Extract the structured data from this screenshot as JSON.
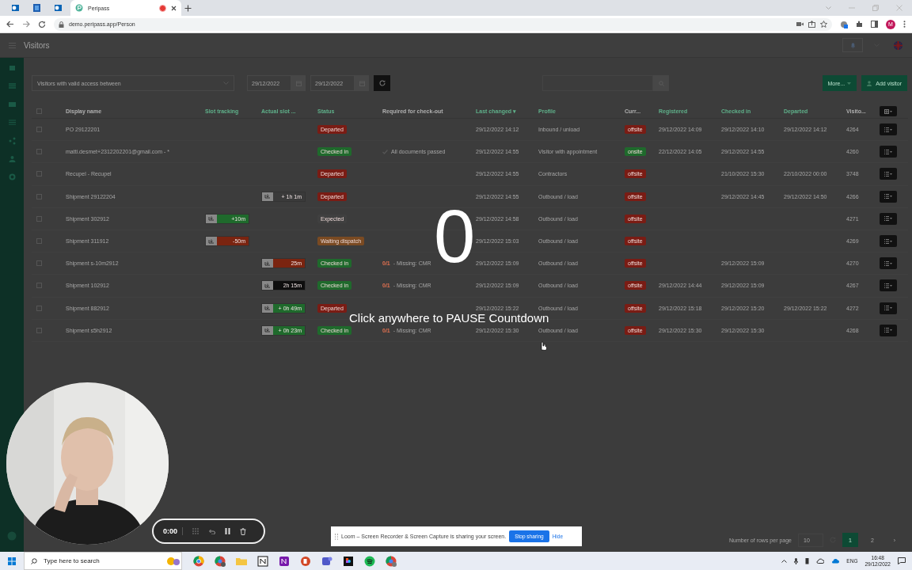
{
  "browser": {
    "tabs": [
      {
        "kind": "icon",
        "selected": false
      },
      {
        "kind": "icon",
        "selected": false
      },
      {
        "kind": "icon",
        "selected": false
      },
      {
        "kind": "page",
        "title": "Peripass",
        "recording": true,
        "selected": true
      }
    ],
    "address": "demo.peripass.app/Person",
    "profile_initial": "M"
  },
  "app": {
    "title": "Visitors",
    "filter": "Visitors with valid access between",
    "date_from": "29/12/2022",
    "date_to": "29/12/2022",
    "buttons": [
      "More...",
      "Add visitor"
    ]
  },
  "table": {
    "select_all_checked": false,
    "columns": [
      {
        "label": "Display name",
        "sortable": false
      },
      {
        "label": "Slot tracking",
        "sortable": true
      },
      {
        "label": "Actual slot ...",
        "sortable": true
      },
      {
        "label": "Status",
        "sortable": true
      },
      {
        "label": "Required for check-out",
        "sortable": false
      },
      {
        "label": "Last changed ▾",
        "sortable": true
      },
      {
        "label": "Profile",
        "sortable": true
      },
      {
        "label": "Curr...",
        "sortable": false
      },
      {
        "label": "Registered",
        "sortable": true
      },
      {
        "label": "Checked in",
        "sortable": true
      },
      {
        "label": "Departed",
        "sortable": true
      },
      {
        "label": "Visito...",
        "sortable": false
      }
    ],
    "rows": [
      {
        "checked": false,
        "name": "PO 29122201",
        "status": {
          "text": "Departed",
          "color": "#7a1c14"
        },
        "last_changed": "29/12/2022 14:12",
        "profile": "Inbound / unload",
        "presence": {
          "text": "offsite",
          "color": "#7a1c14"
        },
        "registered": "29/12/2022 14:09",
        "checked_in": "29/12/2022 14:10",
        "departed": "29/12/2022 14:12",
        "visitor_id": "4264"
      },
      {
        "checked": false,
        "name": "matti.desmet+2312202201@gmail.com - *",
        "status": {
          "text": "Checked in",
          "color": "#1f6a2c"
        },
        "required": {
          "kind": "passed",
          "text": "All documents passed"
        },
        "last_changed": "29/12/2022 14:55",
        "profile": "Visitor with appointment",
        "presence": {
          "text": "onsite",
          "color": "#1f6a2c"
        },
        "registered": "22/12/2022 14:05",
        "checked_in": "29/12/2022 14:55",
        "visitor_id": "4260"
      },
      {
        "checked": false,
        "name": "Recupel - Recupel",
        "status": {
          "text": "Departed",
          "color": "#7a1c14"
        },
        "last_changed": "29/12/2022 14:55",
        "profile": "Contractors",
        "presence": {
          "text": "offsite",
          "color": "#7a1c14"
        },
        "checked_in": "21/10/2022 15:30",
        "departed": "22/10/2022 00:00",
        "visitor_id": "3748"
      },
      {
        "checked": false,
        "name": "Shipment 29122204",
        "actual_slot": {
          "text": "+ 1h 1m",
          "color": "#3a3a3a"
        },
        "status": {
          "text": "Departed",
          "color": "#7a1c14"
        },
        "last_changed": "29/12/2022 14:55",
        "profile": "Outbound / load",
        "presence": {
          "text": "offsite",
          "color": "#7a1c14"
        },
        "checked_in": "29/12/2022 14:45",
        "departed": "29/12/2022 14:50",
        "visitor_id": "4266"
      },
      {
        "checked": false,
        "name": "Shipment 302912",
        "slot": {
          "text": "+10m",
          "color": "#1f6a2c"
        },
        "status": {
          "text": "Expected",
          "color": "#404040"
        },
        "last_changed": "29/12/2022 14:58",
        "profile": "Outbound / load",
        "presence": {
          "text": "offsite",
          "color": "#7a1c14"
        },
        "visitor_id": "4271"
      },
      {
        "checked": false,
        "name": "Shipment 311912",
        "slot": {
          "text": "-50m",
          "color": "#7a2410"
        },
        "status": {
          "text": "Waiting dispatch",
          "color": "#7a4a22"
        },
        "last_changed": "29/12/2022 15:03",
        "profile": "Outbound / load",
        "presence": {
          "text": "offsite",
          "color": "#7a1c14"
        },
        "visitor_id": "4269"
      },
      {
        "checked": false,
        "name": "Shipment s-10m2912",
        "actual_slot": {
          "text": "25m",
          "color": "#7a2410"
        },
        "status": {
          "text": "Checked in",
          "color": "#1f6a2c"
        },
        "required": {
          "kind": "missing",
          "count": "0/1",
          "text": "- Missing: CMR"
        },
        "last_changed": "29/12/2022 15:09",
        "profile": "Outbound / load",
        "presence": {
          "text": "offsite",
          "color": "#7a1c14"
        },
        "checked_in": "29/12/2022 15:09",
        "visitor_id": "4270"
      },
      {
        "checked": false,
        "name": "Shipment 102912",
        "actual_slot": {
          "text": "2h 15m",
          "color": "#0e0e0e"
        },
        "status": {
          "text": "Checked in",
          "color": "#1f6a2c"
        },
        "required": {
          "kind": "missing",
          "count": "0/1",
          "text": "- Missing: CMR"
        },
        "last_changed": "29/12/2022 15:09",
        "profile": "Outbound / load",
        "presence": {
          "text": "offsite",
          "color": "#7a1c14"
        },
        "registered": "29/12/2022 14:44",
        "checked_in": "29/12/2022 15:09",
        "visitor_id": "4267"
      },
      {
        "checked": false,
        "name": "Shipment 882912",
        "actual_slot": {
          "text": "+ 0h 49m",
          "color": "#1f6a2c"
        },
        "status": {
          "text": "Departed",
          "color": "#7a1c14"
        },
        "last_changed": "29/12/2022 15:22",
        "profile": "Outbound / load",
        "presence": {
          "text": "offsite",
          "color": "#7a1c14"
        },
        "registered": "29/12/2022 15:18",
        "checked_in": "29/12/2022 15:20",
        "departed": "29/12/2022 15:22",
        "visitor_id": "4272"
      },
      {
        "checked": false,
        "name": "Shipment s5h2912",
        "actual_slot": {
          "text": "+ 0h 23m",
          "color": "#1f6a2c"
        },
        "status": {
          "text": "Checked in",
          "color": "#1f6a2c"
        },
        "required": {
          "kind": "missing",
          "count": "0/1",
          "text": "- Missing: CMR"
        },
        "last_changed": "29/12/2022 15:30",
        "profile": "Outbound / load",
        "presence": {
          "text": "offsite",
          "color": "#7a1c14"
        },
        "registered": "29/12/2022 15:30",
        "checked_in": "29/12/2022 15:30",
        "visitor_id": "4268"
      }
    ]
  },
  "pagination": {
    "label": "Number of rows per page",
    "rows_per_page": "10",
    "pages": [
      {
        "label": "1",
        "selected": true
      },
      {
        "label": "2",
        "selected": false
      }
    ],
    "next": "›"
  },
  "countdown": {
    "number": "0",
    "hint": "Click anywhere to PAUSE Countdown"
  },
  "recorder": {
    "time": "0:00"
  },
  "sharing_bar": {
    "text": "Loom – Screen Recorder & Screen Capture is sharing your screen.",
    "stop": "Stop sharing",
    "hide": "Hide"
  },
  "taskbar": {
    "search_placeholder": "Type here to search",
    "language": "ENG",
    "time": "16:48",
    "date": "29/12/2022"
  }
}
